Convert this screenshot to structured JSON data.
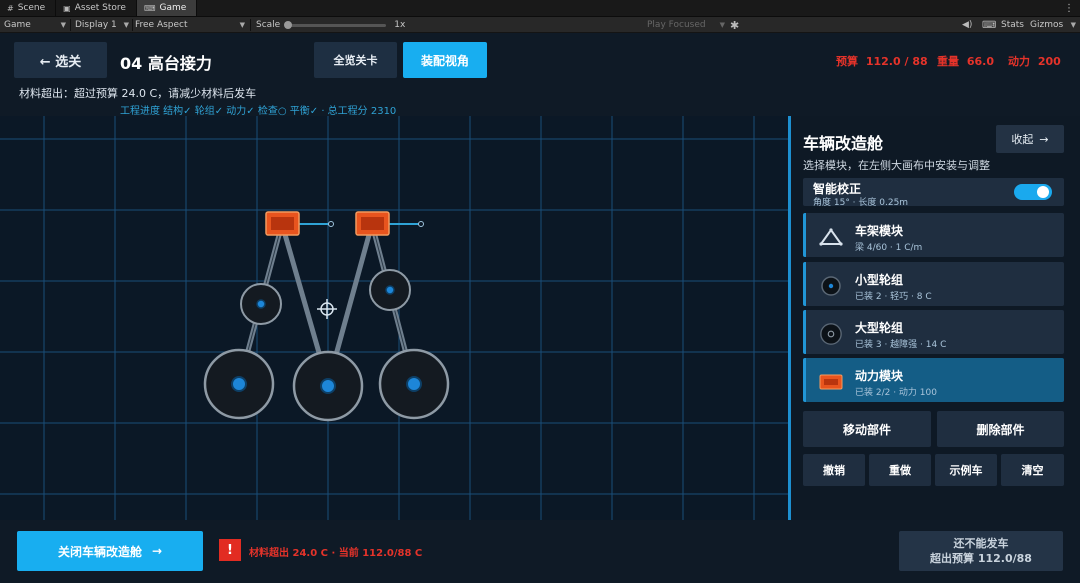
{
  "editor": {
    "tabs": [
      {
        "label": "Scene",
        "icon": "grid-icon"
      },
      {
        "label": "Asset Store",
        "icon": "bag-icon"
      },
      {
        "label": "Game",
        "icon": "gamepad-icon"
      }
    ],
    "toolbar": {
      "view_dropdown": "Game",
      "display_dropdown": "Display 1",
      "aspect_dropdown": "Free Aspect",
      "scale_label": "Scale",
      "scale_value": "1x",
      "play_mode_dropdown": "Play Focused",
      "stats_label": "Stats",
      "gizmos_label": "Gizmos"
    }
  },
  "header": {
    "back_button": "← 选关",
    "level_title": "04  高台接力",
    "overview_button": "全览关卡",
    "assembly_view_button": "装配视角",
    "stats": {
      "budget_label": "预算",
      "budget_value": "112.0 / 88",
      "weight_label": "重量",
      "weight_value": "66.0",
      "power_label": "动力",
      "power_value": "200"
    },
    "warning_text": "材料超出：超过预算 24.0 C，请减少材料后发车",
    "progress_text": "工程进度  结构✓ 轮组✓ 动力✓ 检查○ 平衡✓  ·  总工程分 2310"
  },
  "panel": {
    "title": "车辆改造舱",
    "subtitle": "选择模块，在左侧大画布中安装与调整",
    "collapse_button": "收起",
    "smart_align": {
      "title": "智能校正",
      "detail": "角度 15°  ·  长度 0.25m",
      "enabled": true
    },
    "modules": [
      {
        "title": "车架模块",
        "detail": "梁 4/60  ·  1 C/m",
        "icon": "frame-triangle-icon",
        "selected": false
      },
      {
        "title": "小型轮组",
        "detail": "已装 2  ·  轻巧  ·  8 C",
        "icon": "small-wheel-icon",
        "selected": false
      },
      {
        "title": "大型轮组",
        "detail": "已装 3  ·  越障强  ·  14 C",
        "icon": "large-wheel-icon",
        "selected": false
      },
      {
        "title": "动力模块",
        "detail": "已装 2/2  ·  动力 100",
        "icon": "motor-module-icon",
        "selected": true
      }
    ],
    "move_button": "移动部件",
    "delete_button": "删除部件",
    "undo_button": "撤销",
    "redo_button": "重做",
    "example_button": "示例车",
    "clear_button": "清空"
  },
  "footer": {
    "close_button": "关闭车辆改造舱",
    "alert_icon": "!",
    "alert_text": "材料超出  24.0 C  ·  当前 112.0/88 C",
    "launch_line1": "还不能发车",
    "launch_line2": "超出预算 112.0/88"
  },
  "colors": {
    "accent": "#18aef0",
    "danger": "#e5332a",
    "panel_bg": "#0e1925",
    "grid_line": "#1a4e78",
    "motor_orange": "#e8541e"
  }
}
